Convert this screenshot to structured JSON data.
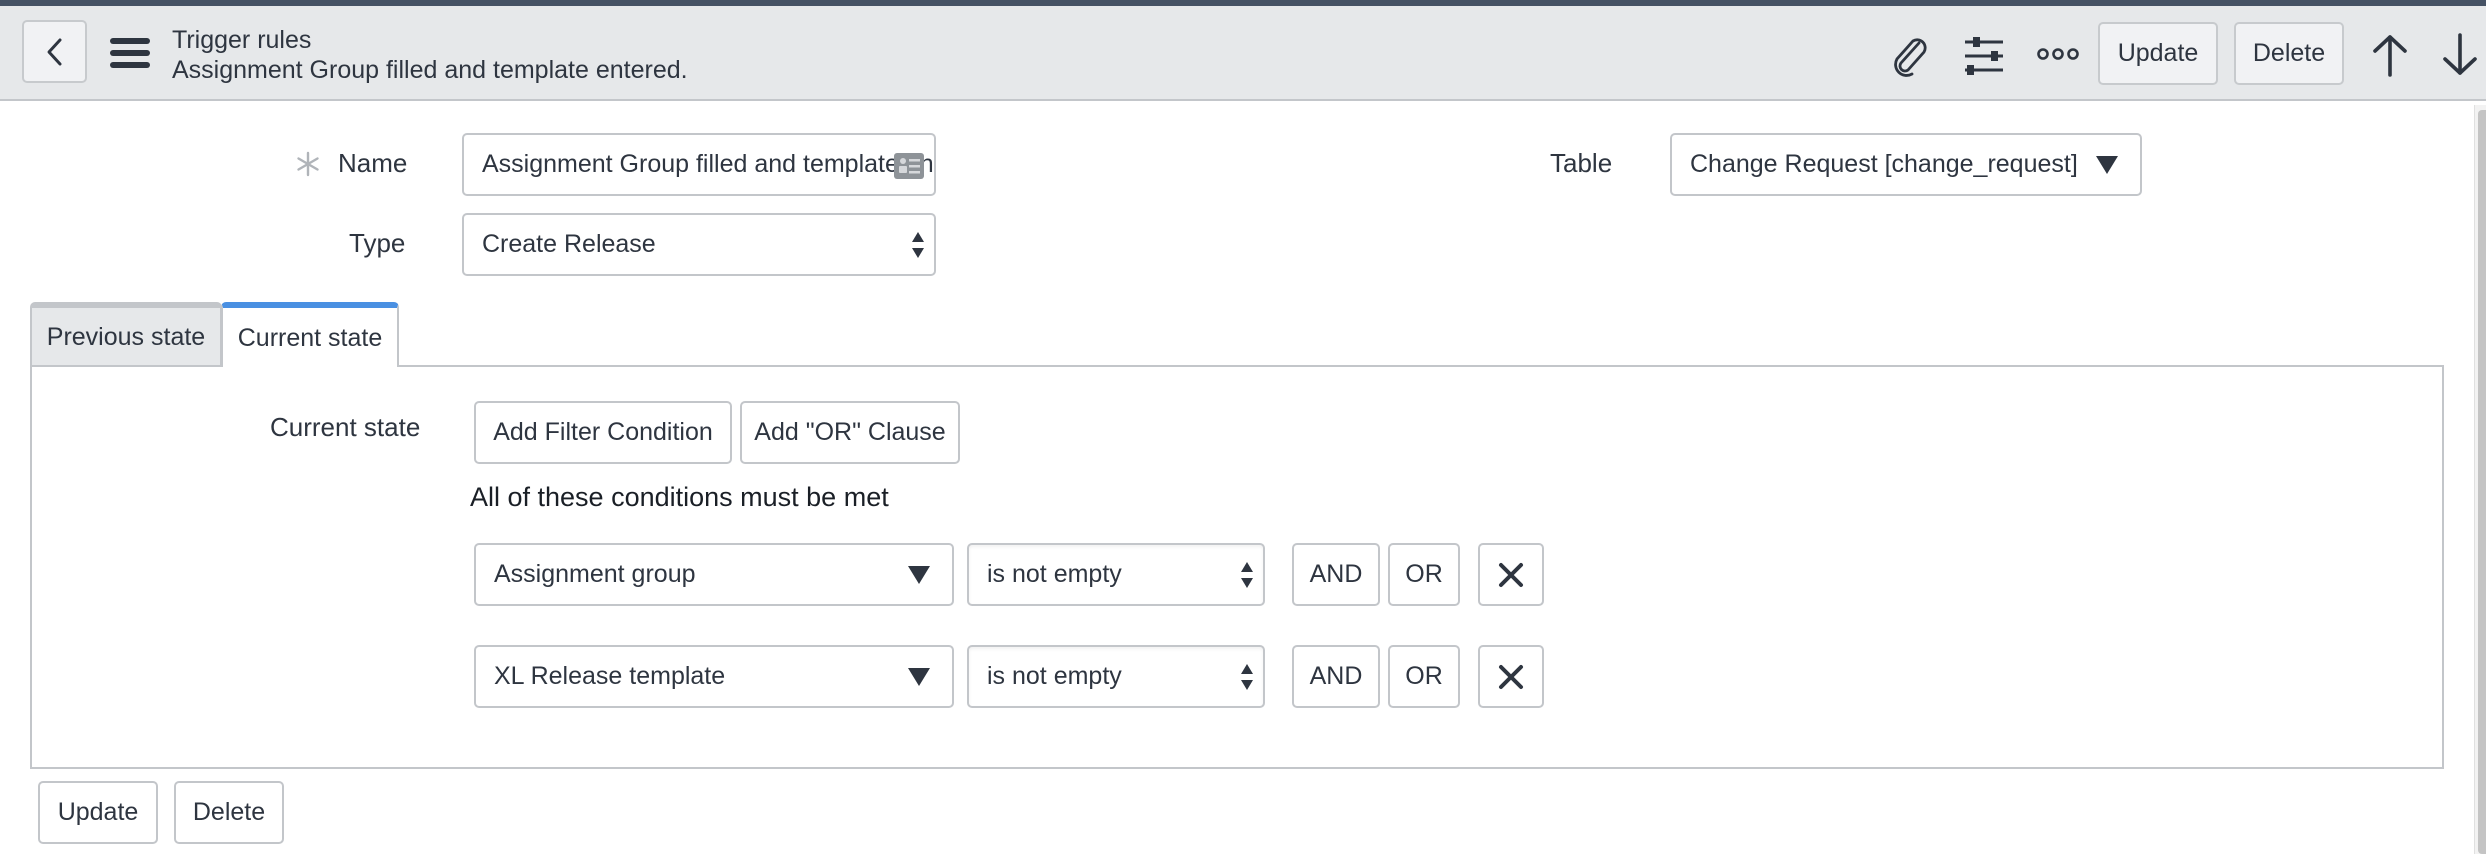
{
  "header": {
    "title": "Trigger rules",
    "subtitle": "Assignment Group filled and template entered.",
    "back_icon": "chevron-left-icon",
    "menu_icon": "hamburger-icon",
    "actions": {
      "attachment_icon": "paperclip-icon",
      "personalize_icon": "sliders-icon",
      "more_icon": "more-options-icon",
      "update_label": "Update",
      "delete_label": "Delete",
      "prev_record_icon": "arrow-up-icon",
      "next_record_icon": "arrow-down-icon"
    }
  },
  "form": {
    "name": {
      "label": "Name",
      "required": true,
      "value": "Assignment Group filled and template entered."
    },
    "type": {
      "label": "Type",
      "value": "Create Release"
    },
    "table": {
      "label": "Table",
      "value": "Change Request [change_request]"
    }
  },
  "tabs": [
    {
      "label": "Previous state",
      "active": false
    },
    {
      "label": "Current state",
      "active": true
    }
  ],
  "condition_builder": {
    "label": "Current state",
    "add_filter_label": "Add Filter Condition",
    "add_or_label": "Add \"OR\" Clause",
    "match_text": "All of these conditions must be met",
    "conditions": [
      {
        "field": "Assignment group",
        "operator": "is not empty",
        "and_label": "AND",
        "or_label": "OR"
      },
      {
        "field": "XL Release template",
        "operator": "is not empty",
        "and_label": "AND",
        "or_label": "OR"
      }
    ]
  },
  "footer": {
    "update_label": "Update",
    "delete_label": "Delete"
  },
  "colors": {
    "topstrip": "#455264",
    "header_bg": "#e6e8ea",
    "active_tab_accent": "#4a90e2",
    "border": "#c3c6ca",
    "text": "#2e3540"
  }
}
